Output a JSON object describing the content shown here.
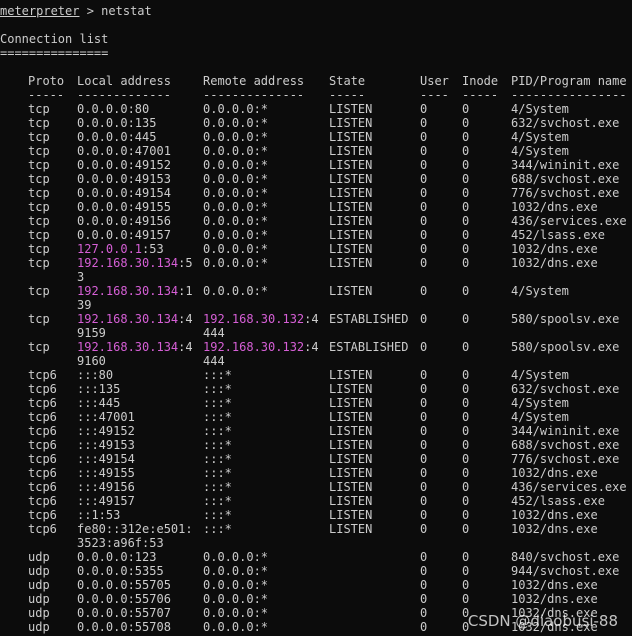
{
  "prompt": {
    "program": "meterpreter",
    "arrow": " > ",
    "command": "netstat"
  },
  "title": "Connection list",
  "title_underline": "===============",
  "headers": {
    "proto": "Proto",
    "local": "Local address",
    "remote": "Remote address",
    "state": "State",
    "user": "User",
    "inode": "Inode",
    "pid": "PID/Program name"
  },
  "header_dashes": {
    "proto": "-----",
    "local": "-------------",
    "remote": "--------------",
    "state": "-----",
    "user": "----",
    "inode": "-----",
    "pid": "----------------"
  },
  "rows": [
    {
      "proto": "tcp",
      "local": "0.0.0.0:80",
      "remote": "0.0.0.0:*",
      "state": "LISTEN",
      "user": "0",
      "inode": "0",
      "pid": "4/System"
    },
    {
      "proto": "tcp",
      "local": "0.0.0.0:135",
      "remote": "0.0.0.0:*",
      "state": "LISTEN",
      "user": "0",
      "inode": "0",
      "pid": "632/svchost.exe"
    },
    {
      "proto": "tcp",
      "local": "0.0.0.0:445",
      "remote": "0.0.0.0:*",
      "state": "LISTEN",
      "user": "0",
      "inode": "0",
      "pid": "4/System"
    },
    {
      "proto": "tcp",
      "local": "0.0.0.0:47001",
      "remote": "0.0.0.0:*",
      "state": "LISTEN",
      "user": "0",
      "inode": "0",
      "pid": "4/System"
    },
    {
      "proto": "tcp",
      "local": "0.0.0.0:49152",
      "remote": "0.0.0.0:*",
      "state": "LISTEN",
      "user": "0",
      "inode": "0",
      "pid": "344/wininit.exe"
    },
    {
      "proto": "tcp",
      "local": "0.0.0.0:49153",
      "remote": "0.0.0.0:*",
      "state": "LISTEN",
      "user": "0",
      "inode": "0",
      "pid": "688/svchost.exe"
    },
    {
      "proto": "tcp",
      "local": "0.0.0.0:49154",
      "remote": "0.0.0.0:*",
      "state": "LISTEN",
      "user": "0",
      "inode": "0",
      "pid": "776/svchost.exe"
    },
    {
      "proto": "tcp",
      "local": "0.0.0.0:49155",
      "remote": "0.0.0.0:*",
      "state": "LISTEN",
      "user": "0",
      "inode": "0",
      "pid": "1032/dns.exe"
    },
    {
      "proto": "tcp",
      "local": "0.0.0.0:49156",
      "remote": "0.0.0.0:*",
      "state": "LISTEN",
      "user": "0",
      "inode": "0",
      "pid": "436/services.exe"
    },
    {
      "proto": "tcp",
      "local": "0.0.0.0:49157",
      "remote": "0.0.0.0:*",
      "state": "LISTEN",
      "user": "0",
      "inode": "0",
      "pid": "452/lsass.exe"
    },
    {
      "proto": "tcp",
      "local_ip": "127.0.0.1",
      "local_rest": ":53",
      "remote": "0.0.0.0:*",
      "state": "LISTEN",
      "user": "0",
      "inode": "0",
      "pid": "1032/dns.exe"
    },
    {
      "proto": "tcp",
      "local_ip": "192.168.30.134",
      "local_rest": ":5",
      "local_wrap": "3",
      "remote": "0.0.0.0:*",
      "state": "LISTEN",
      "user": "0",
      "inode": "0",
      "pid": "1032/dns.exe"
    },
    {
      "proto": "tcp",
      "local_ip": "192.168.30.134",
      "local_rest": ":1",
      "local_wrap": "39",
      "remote": "0.0.0.0:*",
      "state": "LISTEN",
      "user": "0",
      "inode": "0",
      "pid": "4/System"
    },
    {
      "proto": "tcp",
      "local_ip": "192.168.30.134",
      "local_rest": ":4",
      "local_wrap": "9159",
      "remote_ip": "192.168.30.132",
      "remote_rest": ":4",
      "remote_wrap": "444",
      "state": "ESTABLISHED",
      "user": "0",
      "inode": "0",
      "pid": "580/spoolsv.exe"
    },
    {
      "proto": "tcp",
      "local_ip": "192.168.30.134",
      "local_rest": ":4",
      "local_wrap": "9160",
      "remote_ip": "192.168.30.132",
      "remote_rest": ":4",
      "remote_wrap": "444",
      "state": "ESTABLISHED",
      "user": "0",
      "inode": "0",
      "pid": "580/spoolsv.exe"
    },
    {
      "proto": "tcp6",
      "local": ":::80",
      "remote": ":::*",
      "state": "LISTEN",
      "user": "0",
      "inode": "0",
      "pid": "4/System"
    },
    {
      "proto": "tcp6",
      "local": ":::135",
      "remote": ":::*",
      "state": "LISTEN",
      "user": "0",
      "inode": "0",
      "pid": "632/svchost.exe"
    },
    {
      "proto": "tcp6",
      "local": ":::445",
      "remote": ":::*",
      "state": "LISTEN",
      "user": "0",
      "inode": "0",
      "pid": "4/System"
    },
    {
      "proto": "tcp6",
      "local": ":::47001",
      "remote": ":::*",
      "state": "LISTEN",
      "user": "0",
      "inode": "0",
      "pid": "4/System"
    },
    {
      "proto": "tcp6",
      "local": ":::49152",
      "remote": ":::*",
      "state": "LISTEN",
      "user": "0",
      "inode": "0",
      "pid": "344/wininit.exe"
    },
    {
      "proto": "tcp6",
      "local": ":::49153",
      "remote": ":::*",
      "state": "LISTEN",
      "user": "0",
      "inode": "0",
      "pid": "688/svchost.exe"
    },
    {
      "proto": "tcp6",
      "local": ":::49154",
      "remote": ":::*",
      "state": "LISTEN",
      "user": "0",
      "inode": "0",
      "pid": "776/svchost.exe"
    },
    {
      "proto": "tcp6",
      "local": ":::49155",
      "remote": ":::*",
      "state": "LISTEN",
      "user": "0",
      "inode": "0",
      "pid": "1032/dns.exe"
    },
    {
      "proto": "tcp6",
      "local": ":::49156",
      "remote": ":::*",
      "state": "LISTEN",
      "user": "0",
      "inode": "0",
      "pid": "436/services.exe"
    },
    {
      "proto": "tcp6",
      "local": ":::49157",
      "remote": ":::*",
      "state": "LISTEN",
      "user": "0",
      "inode": "0",
      "pid": "452/lsass.exe"
    },
    {
      "proto": "tcp6",
      "local": "::1:53",
      "remote": ":::*",
      "state": "LISTEN",
      "user": "0",
      "inode": "0",
      "pid": "1032/dns.exe"
    },
    {
      "proto": "tcp6",
      "local": "fe80::312e:e501:",
      "local_wrap": "3523:a96f:53",
      "remote": ":::*",
      "state": "LISTEN",
      "user": "0",
      "inode": "0",
      "pid": "1032/dns.exe"
    },
    {
      "proto": "udp",
      "local": "0.0.0.0:123",
      "remote": "0.0.0.0:*",
      "state": "",
      "user": "0",
      "inode": "0",
      "pid": "840/svchost.exe"
    },
    {
      "proto": "udp",
      "local": "0.0.0.0:5355",
      "remote": "0.0.0.0:*",
      "state": "",
      "user": "0",
      "inode": "0",
      "pid": "944/svchost.exe"
    },
    {
      "proto": "udp",
      "local": "0.0.0.0:55705",
      "remote": "0.0.0.0:*",
      "state": "",
      "user": "0",
      "inode": "0",
      "pid": "1032/dns.exe"
    },
    {
      "proto": "udp",
      "local": "0.0.0.0:55706",
      "remote": "0.0.0.0:*",
      "state": "",
      "user": "0",
      "inode": "0",
      "pid": "1032/dns.exe"
    },
    {
      "proto": "udp",
      "local": "0.0.0.0:55707",
      "remote": "0.0.0.0:*",
      "state": "",
      "user": "0",
      "inode": "0",
      "pid": "1032/dns.exe"
    },
    {
      "proto": "udp",
      "local": "0.0.0.0:55708",
      "remote": "0.0.0.0:*",
      "state": "",
      "user": "0",
      "inode": "0",
      "pid": "1032/dns.exe"
    }
  ],
  "watermark": "CSDN @diaobusi-88",
  "colors": {
    "background": "#0c0c0c",
    "text": "#cccccc",
    "ip_highlight": "#d65fd6"
  }
}
